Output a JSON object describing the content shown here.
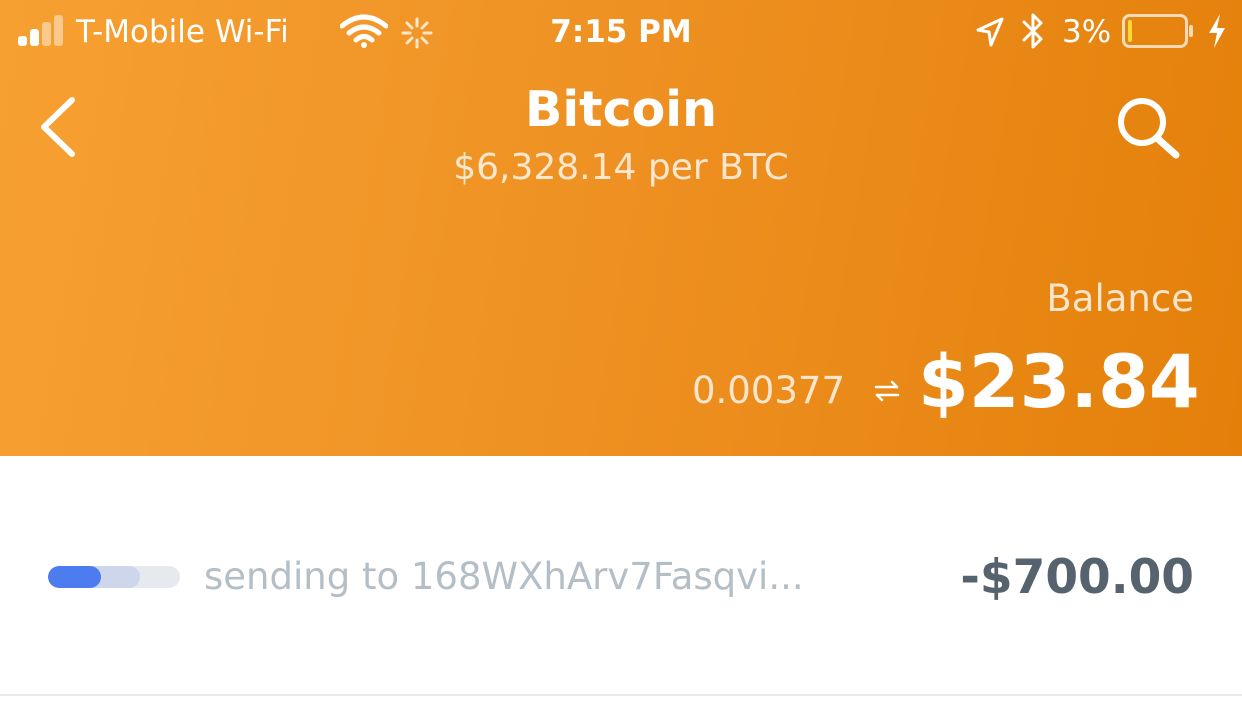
{
  "status_bar": {
    "carrier": "T-Mobile Wi-Fi",
    "time": "7:15 PM",
    "battery_percent": "3%",
    "battery_level": 0.03,
    "signal_bars_active": 2,
    "signal_bars_total": 4,
    "icons": [
      "signal-icon",
      "wifi-icon",
      "activity-spinner-icon",
      "location-arrow-icon",
      "bluetooth-icon",
      "battery-icon",
      "charging-bolt-icon"
    ]
  },
  "header": {
    "title": "Bitcoin",
    "subtitle": "$6,328.14 per BTC",
    "back_icon": "chevron-left-icon",
    "search_icon": "search-icon"
  },
  "balance": {
    "label": "Balance",
    "crypto_amount": "0.00377",
    "fiat_amount": "$23.84",
    "swap_icon": "swap-arrows-icon"
  },
  "transactions": [
    {
      "description": "sending to 168WXhArv7Fasqvi...",
      "amount": "-$700.00",
      "progress_fraction": 0.4,
      "progress_secondary_fraction": 0.7
    }
  ],
  "colors": {
    "header_gradient_start": "#f7a032",
    "header_gradient_end": "#e4800a",
    "progress_fill": "#4d7cf1",
    "progress_secondary": "#cdd6ea",
    "progress_track": "#e6e9ee",
    "tx_description": "#b3bec7",
    "tx_amount": "#56636e"
  }
}
